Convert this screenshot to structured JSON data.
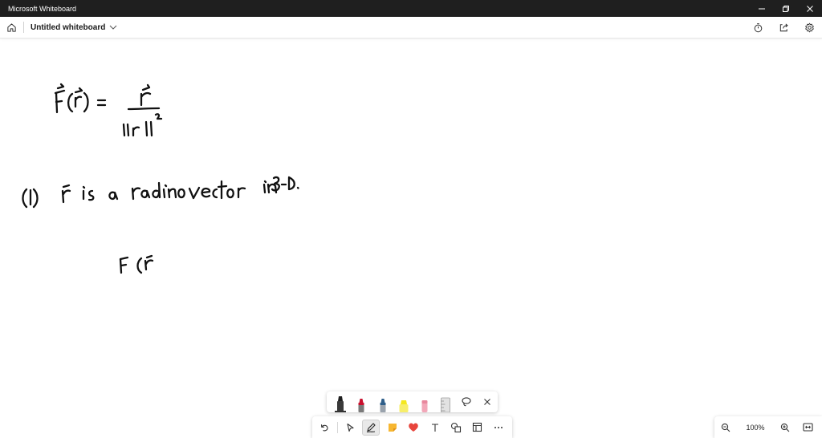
{
  "window": {
    "title": "Microsoft Whiteboard",
    "controls": [
      "minimize-icon",
      "restore-icon",
      "close-icon"
    ]
  },
  "header": {
    "home_icon": "home-icon",
    "board_name": "Untitled whiteboard",
    "right_icons": [
      "timer-icon",
      "share-icon",
      "settings-icon"
    ]
  },
  "pen_tray": {
    "pens": [
      {
        "name": "black-pen",
        "color": "#1f1f1f",
        "selected": true
      },
      {
        "name": "red-pen",
        "color": "#c8102e",
        "selected": false
      },
      {
        "name": "blue-pen",
        "color": "#2f5f8a",
        "selected": false
      },
      {
        "name": "yellow-highlighter",
        "color": "#f4e81e",
        "selected": false
      },
      {
        "name": "pink-highlighter",
        "color": "#f2a7b8",
        "selected": false
      },
      {
        "name": "ruler",
        "color": "#bdbdbd",
        "selected": false
      }
    ],
    "actions": [
      "lasso-icon",
      "close-icon"
    ]
  },
  "toolbar": {
    "tools": [
      "undo-icon",
      "select-icon",
      "pen-icon",
      "sticky-note-icon",
      "reaction-icon",
      "text-icon",
      "shapes-icon",
      "templates-icon",
      "more-icon"
    ],
    "active": "pen-icon"
  },
  "zoom": {
    "level": "100%"
  },
  "colors": {
    "titlebar": "#1f1f1f",
    "ink": "#111111",
    "reaction": "#e8453c",
    "sticky": "#f7b731"
  }
}
